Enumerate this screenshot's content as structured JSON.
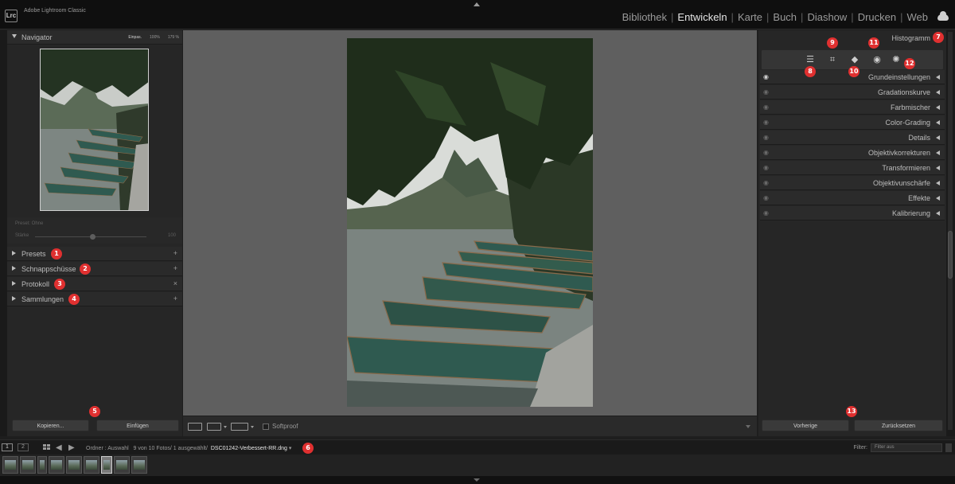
{
  "app": {
    "logo": "Lrc",
    "name": "Adobe Lightroom Classic"
  },
  "modules": [
    "Bibliothek",
    "Entwickeln",
    "Karte",
    "Buch",
    "Diashow",
    "Drucken",
    "Web"
  ],
  "active_module": "Entwickeln",
  "navigator": {
    "title": "Navigator",
    "options": [
      "Einpas.",
      "100%",
      "179 %"
    ],
    "active_option": "Einpas."
  },
  "preset_box": {
    "label": "Preset: Ohne",
    "strength_label": "Stärke",
    "value": "100",
    "slider_fraction": 0.5
  },
  "left_panels": [
    {
      "label": "Presets",
      "action": "+",
      "badge": "1"
    },
    {
      "label": "Schnappschüsse",
      "action": "+",
      "badge": "2"
    },
    {
      "label": "Protokoll",
      "action": "×",
      "badge": "3"
    },
    {
      "label": "Sammlungen",
      "action": "+",
      "badge": "4"
    }
  ],
  "left_buttons": {
    "copy": "Kopieren...",
    "paste": "Einfügen",
    "badge": "5"
  },
  "toolbar": {
    "softproof": "Softproof"
  },
  "right": {
    "histogram_title": "Histogramm",
    "histogram_badge": "7",
    "tools": [
      {
        "icon": "sliders-icon",
        "glyph": "☰",
        "badge": "8"
      },
      {
        "icon": "crop-icon",
        "glyph": "⌗",
        "badge": "9"
      },
      {
        "icon": "eraser-icon",
        "glyph": "◆",
        "badge": "10"
      },
      {
        "icon": "redeye-icon",
        "glyph": "◉",
        "badge": "11"
      },
      {
        "icon": "masking-icon",
        "glyph": "✺",
        "badge": "12"
      }
    ],
    "panels": [
      "Grundeinstellungen",
      "Gradationskurve",
      "Farbmischer",
      "Color-Grading",
      "Details",
      "Objektivkorrekturen",
      "Transformieren",
      "Objektivunschärfe",
      "Effekte",
      "Kalibrierung"
    ],
    "eye_glyph": "◉",
    "prev_button": "Vorherige",
    "reset_button": "Zurücksetzen",
    "buttons_badge": "13"
  },
  "filmstrip": {
    "monitor1": "1",
    "monitor2": "2",
    "source": "Ordner : Auswahl",
    "count": "9 von 10 Fotos/ 1 ausgewählt/",
    "filename": "DSC01242-Verbessert-RR.dng",
    "filename_badge": "6",
    "filter_label": "Filter:",
    "filter_value": "Filter aus",
    "thumb_count": 9,
    "selected_index": 6
  }
}
